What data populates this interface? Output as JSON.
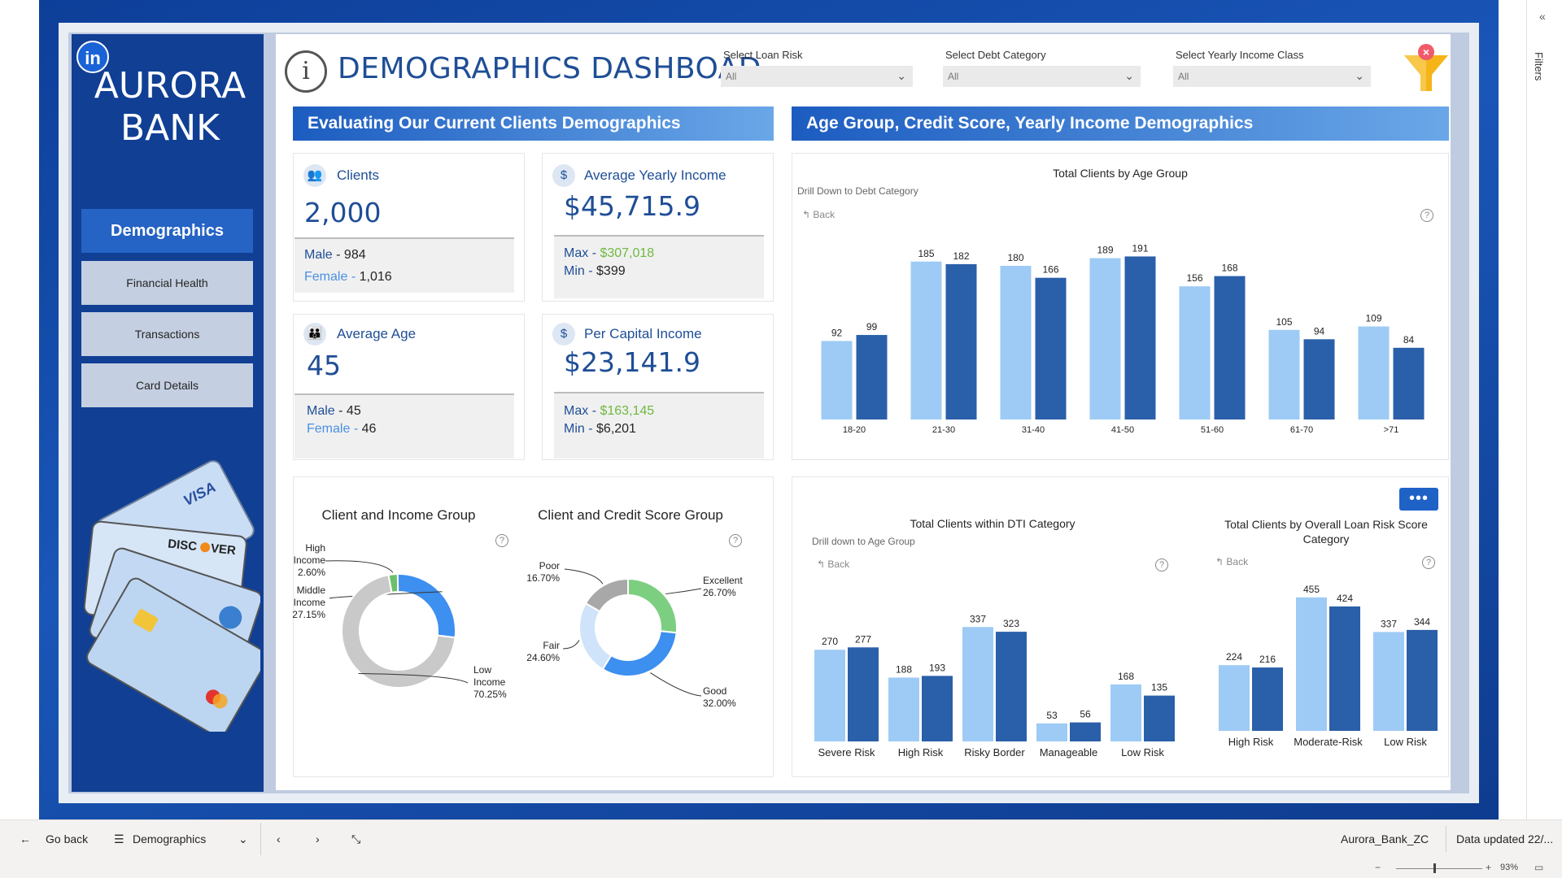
{
  "brand": {
    "logo_text": "in",
    "title_line1": "AURORA",
    "title_line2": "BANK"
  },
  "nav": [
    {
      "label": "Demographics"
    },
    {
      "label": "Financial Health"
    },
    {
      "label": "Transactions"
    },
    {
      "label": "Card Details"
    }
  ],
  "header": {
    "info_glyph": "i",
    "title": "DEMOGRAPHICS DASHBOAD"
  },
  "filters": [
    {
      "label": "Select Loan Risk",
      "value": "All"
    },
    {
      "label": "Select Debt Category",
      "value": "All"
    },
    {
      "label": "Select Yearly Income Class",
      "value": "All"
    }
  ],
  "sections": {
    "left": "Evaluating Our  Current Clients Demographics",
    "right": "Age Group, Credit Score, Yearly Income Demographics"
  },
  "kpis": {
    "clients": {
      "title": "Clients",
      "value": "2,000",
      "male_label": "Male",
      "male_value": "984",
      "female_label": "Female",
      "female_value": "1,016",
      "sep": "-"
    },
    "avg_income": {
      "title": "Average Yearly Income",
      "value": "$45,715.9",
      "max_label": "Max",
      "max_value": "$307,018",
      "min_label": "Min",
      "min_value": "$399",
      "sep": "-"
    },
    "avg_age": {
      "title": "Average Age",
      "value": "45",
      "male_label": "Male",
      "male_value": "45",
      "female_label": "Female",
      "female_value": "46",
      "sep": "-"
    },
    "per_capita": {
      "title": "Per Capital Income",
      "value": "$23,141.9",
      "max_label": "Max",
      "max_value": "$163,145",
      "min_label": "Min",
      "min_value": "$6,201",
      "sep": "-"
    }
  },
  "age_chart_notes": {
    "drill": "Drill Down to Debt Category",
    "back": "Back",
    "help": "?"
  },
  "dti_chart_notes": {
    "drill": "Drill down to Age Group",
    "back": "Back",
    "help": "?"
  },
  "risk_chart_notes": {
    "back": "Back",
    "help": "?"
  },
  "donut_help": "?",
  "more_button": "•••",
  "colors": {
    "series_light": "#9ecbf5",
    "series_dark": "#2a5faa",
    "accent": "#1f4e96",
    "green": "#6fb83f"
  },
  "chart_data": [
    {
      "type": "bar",
      "title": "Total Clients by Age Group",
      "categories": [
        "18-20",
        "21-30",
        "31-40",
        "41-50",
        "51-60",
        "61-70",
        ">71"
      ],
      "series": [
        {
          "values": [
            92,
            185,
            180,
            189,
            156,
            105,
            109
          ]
        },
        {
          "values": [
            99,
            182,
            166,
            191,
            168,
            94,
            84
          ]
        }
      ],
      "ylim": [
        0,
        200
      ]
    },
    {
      "type": "pie",
      "title": "Client and Income Group",
      "labels": [
        "High Income",
        "Middle Income",
        "Low Income"
      ],
      "values": [
        2.6,
        27.15,
        70.25
      ],
      "display": [
        "High\nIncome\n2.60%",
        "Middle\nIncome\n27.15%",
        "Low\nIncome\n70.25%"
      ],
      "colors": [
        "#6cc06c",
        "#3d8ff0",
        "#c9c9c9"
      ]
    },
    {
      "type": "pie",
      "title": "Client and Credit Score Group",
      "labels": [
        "Excellent",
        "Good",
        "Fair",
        "Poor"
      ],
      "values": [
        26.7,
        32.0,
        24.6,
        16.7
      ],
      "display": [
        "Excellent\n26.70%",
        "Good\n32.00%",
        "Fair\n24.60%",
        "Poor\n16.70%"
      ],
      "colors": [
        "#7ccf80",
        "#3d8ff0",
        "#cfe3fa",
        "#a8a8a8"
      ]
    },
    {
      "type": "bar",
      "title": "Total Clients within DTI Category",
      "categories": [
        "Severe Risk",
        "High Risk",
        "Risky Border",
        "Manageable",
        "Low Risk"
      ],
      "series": [
        {
          "values": [
            270,
            188,
            337,
            53,
            168
          ]
        },
        {
          "values": [
            277,
            193,
            323,
            56,
            135
          ]
        }
      ],
      "ylim": [
        0,
        340
      ]
    },
    {
      "type": "bar",
      "title": "Total Clients by Overall Loan Risk Score Category",
      "categories": [
        "High Risk",
        "Moderate-Risk",
        "Low Risk"
      ],
      "series": [
        {
          "values": [
            224,
            455,
            337
          ]
        },
        {
          "values": [
            216,
            424,
            344
          ]
        }
      ],
      "ylim": [
        0,
        460
      ]
    }
  ],
  "bottom_bar": {
    "go_back": "Go back",
    "page": "Demographics",
    "file": "Aurora_Bank_ZC",
    "updated": "Data updated 22/...",
    "zoom": "93%"
  },
  "filters_pane": "Filters"
}
